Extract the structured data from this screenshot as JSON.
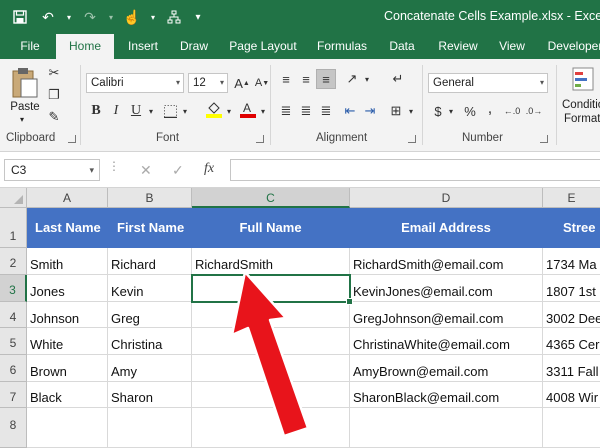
{
  "window": {
    "title": "Concatenate Cells Example.xlsx - Excel"
  },
  "tabs": [
    "File",
    "Home",
    "Insert",
    "Draw",
    "Page Layout",
    "Formulas",
    "Data",
    "Review",
    "View",
    "Developer"
  ],
  "active_tab": "Home",
  "ribbon": {
    "clipboard": {
      "label": "Clipboard",
      "paste": "Paste"
    },
    "font": {
      "label": "Font",
      "name": "Calibri",
      "size": "12",
      "bold": "B",
      "italic": "I",
      "underline": "U"
    },
    "alignment": {
      "label": "Alignment"
    },
    "number": {
      "label": "Number",
      "format": "General",
      "currency": "$",
      "percent": "%",
      "comma": ","
    },
    "styles": {
      "conditional": "Conditional",
      "format_as": "Formatt"
    }
  },
  "formula_bar": {
    "name_box": "C3",
    "fx": "fx",
    "cancel": "✕",
    "enter": "✓",
    "content": ""
  },
  "sheet": {
    "columns": [
      "A",
      "B",
      "C",
      "D",
      "E"
    ],
    "selected_column": "C",
    "rows": [
      "1",
      "2",
      "3",
      "4",
      "5",
      "6",
      "7",
      "8"
    ],
    "selected_row": "3",
    "header_row": [
      "Last Name",
      "First Name",
      "Full Name",
      "Email Address",
      "Stree"
    ],
    "data": [
      [
        "Smith",
        "Richard",
        "RichardSmith",
        "RichardSmith@email.com",
        "1734 Ma"
      ],
      [
        "Jones",
        "Kevin",
        "",
        "KevinJones@email.com",
        "1807 1st"
      ],
      [
        "Johnson",
        "Greg",
        "",
        "GregJohnson@email.com",
        "3002 Dee"
      ],
      [
        "White",
        "Christina",
        "",
        "ChristinaWhite@email.com",
        "4365 Cer"
      ],
      [
        "Brown",
        "Amy",
        "",
        "AmyBrown@email.com",
        "3311 Fall"
      ],
      [
        "Black",
        "Sharon",
        "",
        "SharonBlack@email.com",
        "4008 Wir"
      ]
    ],
    "active_cell": "C3"
  },
  "colors": {
    "excel_green": "#217346",
    "header_fill": "#4472c4",
    "arrow_red": "#e8141b"
  }
}
